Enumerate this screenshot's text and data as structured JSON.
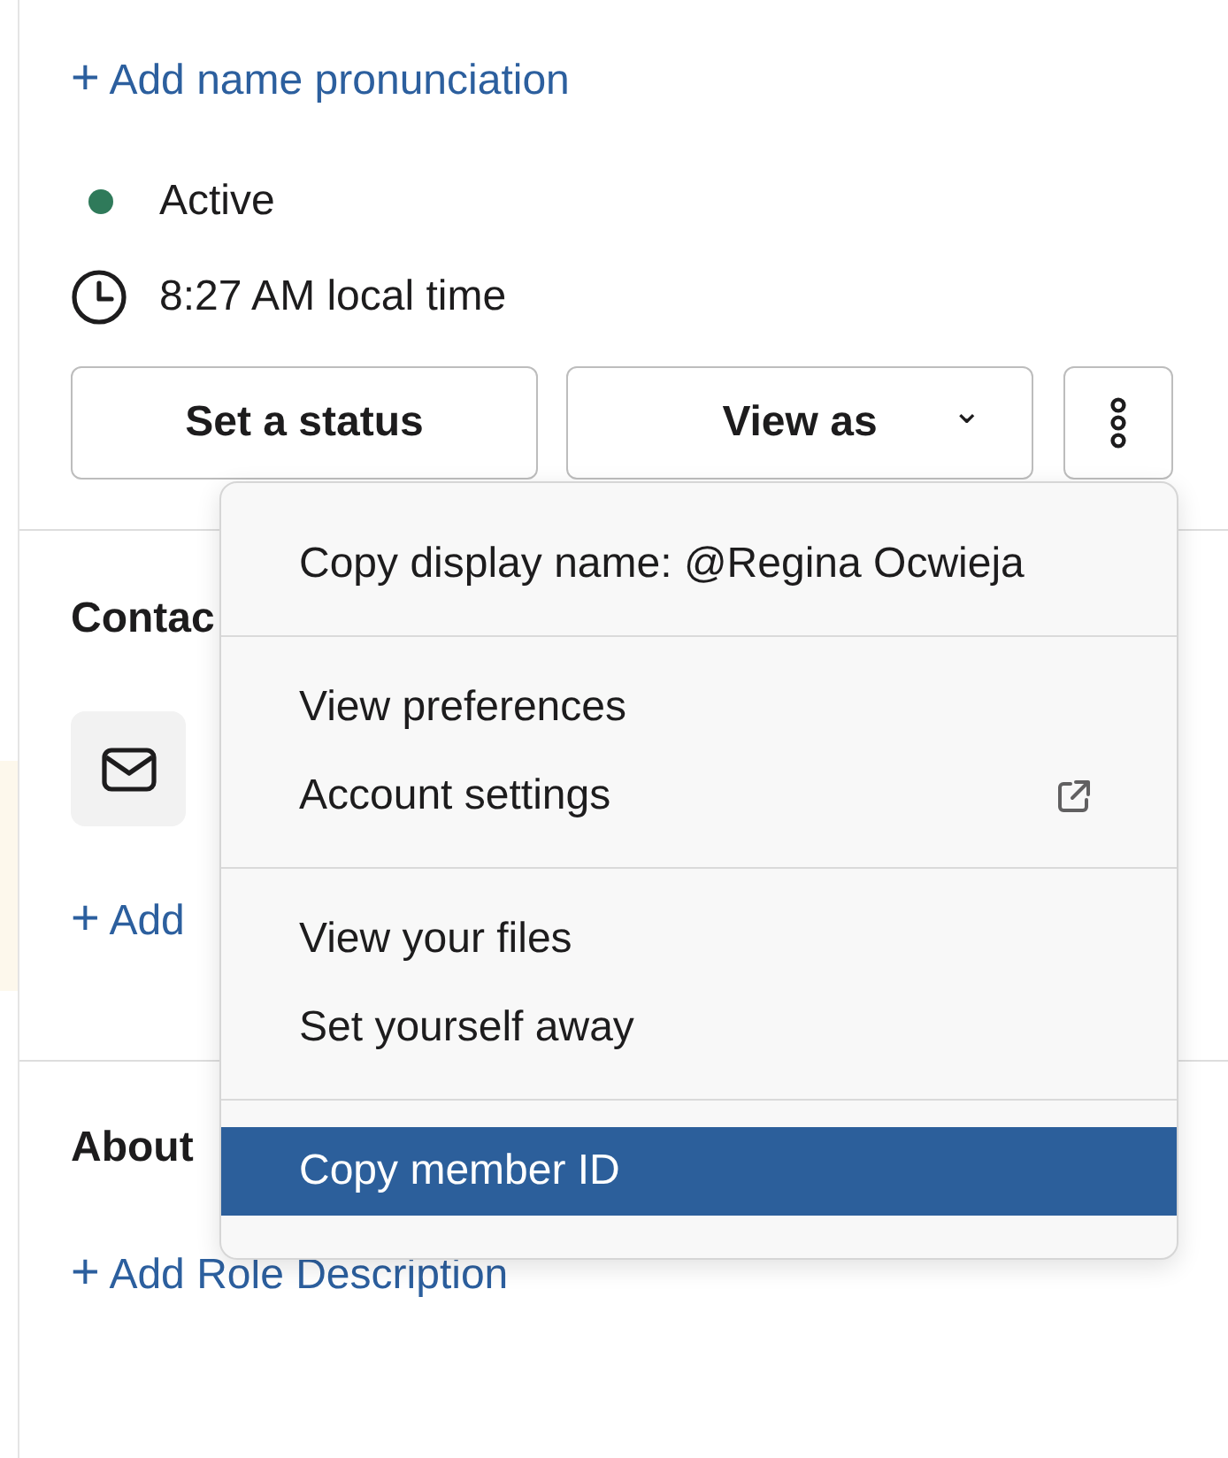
{
  "profile": {
    "pronunciation_link": {
      "icon": "+",
      "label": "Add name pronunciation"
    },
    "presence": {
      "label": "Active",
      "color": "#2f7a5a"
    },
    "local_time": "8:27 AM local time",
    "buttons": [
      {
        "kind": "plain",
        "label": "Set a status"
      },
      {
        "kind": "dropdown",
        "label": "View as",
        "caret": "⌄"
      },
      {
        "kind": "more"
      }
    ]
  },
  "contact": {
    "heading": "Contac",
    "add_link": {
      "icon": "+",
      "label": "Add"
    }
  },
  "about": {
    "heading": "About",
    "add_link": {
      "icon": "+",
      "label": "Add Role Description"
    }
  },
  "menu": {
    "groups": [
      [
        {
          "label": "Copy display name: @Regina Ocwieja",
          "external": false,
          "selected": false
        }
      ],
      [
        {
          "label": "View preferences",
          "external": false,
          "selected": false
        },
        {
          "label": "Account settings",
          "external": true,
          "selected": false
        }
      ],
      [
        {
          "label": "View your files",
          "external": false,
          "selected": false
        },
        {
          "label": "Set yourself away",
          "external": false,
          "selected": false
        }
      ],
      [
        {
          "label": "Copy member ID",
          "external": false,
          "selected": true
        }
      ]
    ]
  }
}
